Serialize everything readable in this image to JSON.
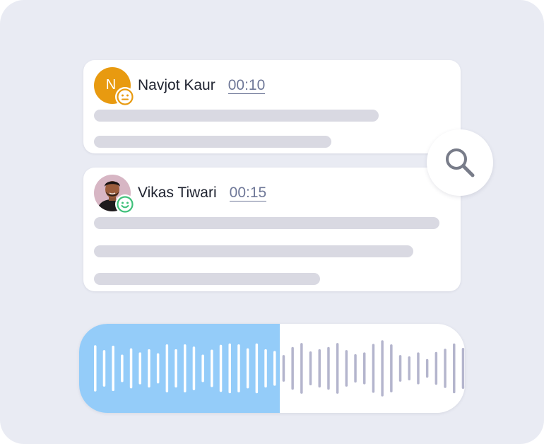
{
  "comments": [
    {
      "author": "Navjot Kaur",
      "initial": "N",
      "timestamp": "00:10",
      "avatar_color": "#e89a10",
      "sentiment": "neutral",
      "sentiment_icon": "neutral-face-icon",
      "sentiment_color": "#e89a10"
    },
    {
      "author": "Vikas Tiwari",
      "timestamp": "00:15",
      "sentiment": "positive",
      "sentiment_icon": "smiley-face-icon",
      "sentiment_color": "#3fc07a"
    }
  ],
  "search_icon": "search-icon",
  "audio": {
    "progress": 0.52,
    "played_color": "#94ccf9",
    "played_wave_color": "#ffffff",
    "unplayed_wave_color": "#b4b5cd",
    "waveform": [
      0.52,
      0.41,
      0.51,
      0.31,
      0.45,
      0.36,
      0.43,
      0.34,
      0.54,
      0.43,
      0.54,
      0.49,
      0.31,
      0.42,
      0.53,
      0.56,
      0.54,
      0.45,
      0.56,
      0.43,
      0.39,
      0.3,
      0.48,
      0.57,
      0.38,
      0.43,
      0.48,
      0.57,
      0.41,
      0.32,
      0.36,
      0.55,
      0.63,
      0.54,
      0.3,
      0.27,
      0.36,
      0.21,
      0.37,
      0.44,
      0.56,
      0.46,
      0.72
    ]
  }
}
